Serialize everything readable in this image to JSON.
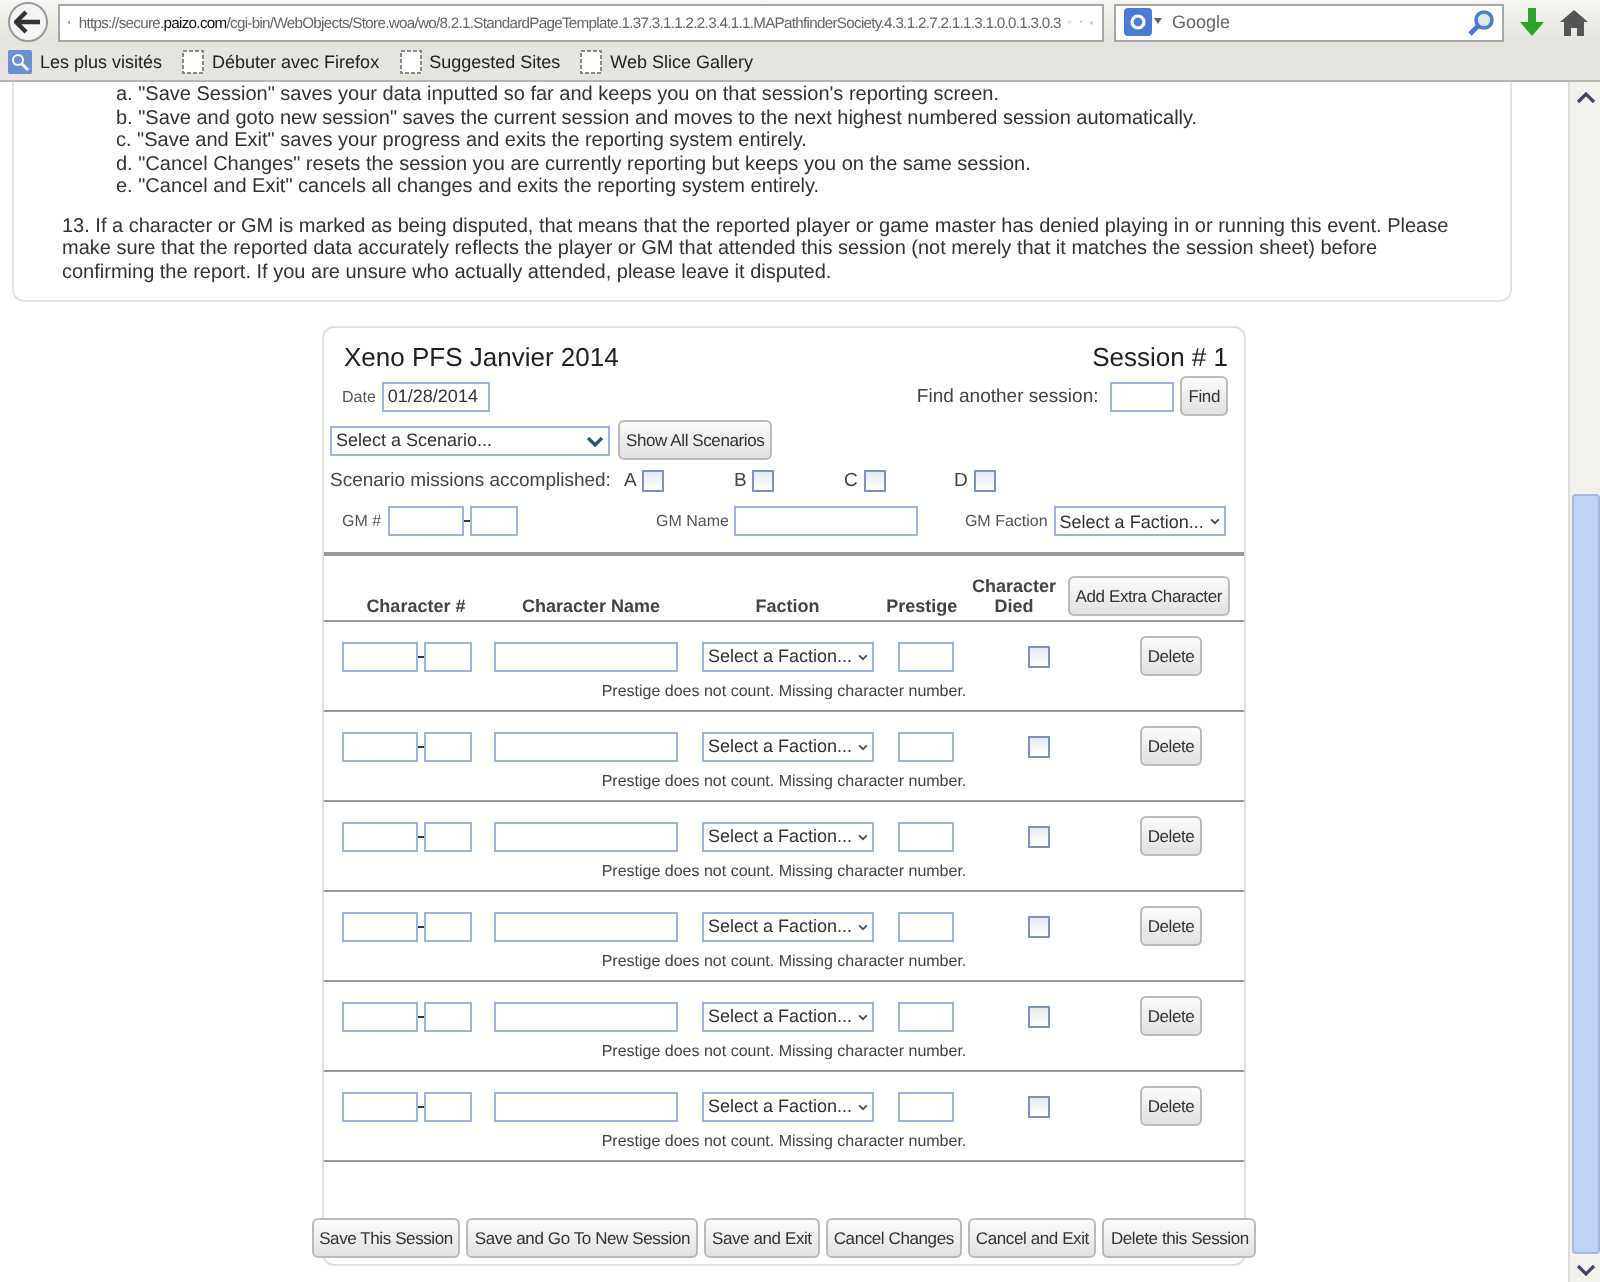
{
  "browser": {
    "url_prefix": "https://secure.",
    "url_domain": "paizo.com",
    "url_rest": "/cgi-bin/WebObjects/Store.woa/wo/8.2.1.StandardPageTemplate.1.37.3.1.1.2.2.3.4.1.1.MAPathfinderSociety.4.3.1.2.7.2.1.1.3.1.0.0.1.3.0.3",
    "search_placeholder": "Google",
    "bookmarks": [
      {
        "label": "Les plus visités",
        "kind": "smart"
      },
      {
        "label": "Débuter avec Firefox",
        "kind": "page"
      },
      {
        "label": "Suggested Sites",
        "kind": "page"
      },
      {
        "label": "Web Slice Gallery",
        "kind": "page"
      }
    ]
  },
  "instructions": {
    "sub_items": [
      "a. \"Save Session\" saves your data inputted so far and keeps you on that session's reporting screen.",
      "b. \"Save and goto new session\" saves the current session and moves to the next highest numbered session automatically.",
      "c. \"Save and Exit\" saves your progress and exits the reporting system entirely.",
      "d. \"Cancel Changes\" resets the session you are currently reporting but keeps you on the same session.",
      "e. \"Cancel and Exit\" cancels all changes and exits the reporting system entirely."
    ],
    "note": "13. If a character or GM is marked as being disputed, that means that the reported player or game master has denied playing in or running this event. Please make sure that the reported data accurately reflects the player or GM that attended this session (not merely that it matches the session sheet) before confirming the report. If you are unsure who actually attended, please leave it disputed."
  },
  "session": {
    "title": "Xeno PFS Janvier 2014",
    "session_label": "Session # 1",
    "date_label": "Date",
    "date_value": "01/28/2014",
    "find_label": "Find another session:",
    "find_button": "Find",
    "scenario_select": "Select a Scenario...",
    "show_all_button": "Show All Scenarios",
    "missions_label": "Scenario missions accomplished:",
    "missions": [
      {
        "label": "A",
        "checked": false
      },
      {
        "label": "B",
        "checked": false
      },
      {
        "label": "C",
        "checked": false
      },
      {
        "label": "D",
        "checked": false
      }
    ],
    "gm_number_label": "GM #",
    "gm_name_label": "GM Name",
    "gm_faction_label": "GM Faction",
    "gm_faction_select": "Select a Faction...",
    "columns": [
      "Character #",
      "Character Name",
      "Faction",
      "Prestige",
      "Character Died"
    ],
    "add_button": "Add Extra Character",
    "rows": [
      {
        "faction": "Select a Faction...",
        "died": false,
        "delete": "Delete",
        "note": "Prestige does not count. Missing character number."
      },
      {
        "faction": "Select a Faction...",
        "died": false,
        "delete": "Delete",
        "note": "Prestige does not count. Missing character number."
      },
      {
        "faction": "Select a Faction...",
        "died": false,
        "delete": "Delete",
        "note": "Prestige does not count. Missing character number."
      },
      {
        "faction": "Select a Faction...",
        "died": false,
        "delete": "Delete",
        "note": "Prestige does not count. Missing character number."
      },
      {
        "faction": "Select a Faction...",
        "died": false,
        "delete": "Delete",
        "note": "Prestige does not count. Missing character number."
      },
      {
        "faction": "Select a Faction...",
        "died": false,
        "delete": "Delete",
        "note": "Prestige does not count. Missing character number."
      }
    ],
    "buttons": [
      "Save This Session",
      "Save and Go To New Session",
      "Save and Exit",
      "Cancel Changes",
      "Cancel and Exit",
      "Delete this Session"
    ]
  }
}
